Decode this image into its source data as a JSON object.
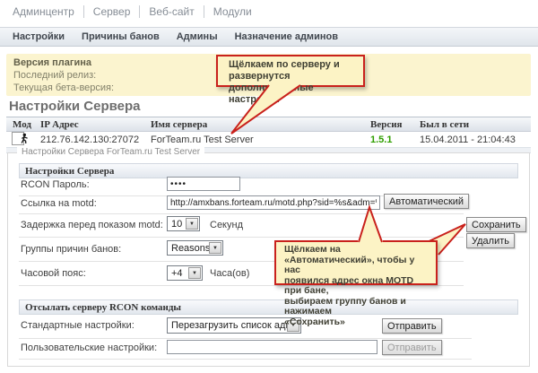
{
  "colors": {
    "accent-red": "#c9211c",
    "callout-bg": "#fcf3c5",
    "band-yellow": "#fbf4cf",
    "version-green": "#2f9e00"
  },
  "topnav": {
    "items": [
      "Админцентр",
      "Сервер",
      "Веб-сайт",
      "Модули"
    ]
  },
  "subnav": {
    "items": [
      "Настройки",
      "Причины банов",
      "Админы",
      "Назначение админов"
    ]
  },
  "plugin_box": {
    "title": "Версия плагина",
    "release_label": "Последний релиз:",
    "beta_label": "Текущая бета-версия:"
  },
  "callout_server": {
    "line1": "Щёлкаем по серверу и развернутся",
    "line2": "дополнительные настройки"
  },
  "callout_motd": {
    "line1": "Щёлкаем на «Автоматический», чтобы у нас",
    "line2": "появился адрес окна MOTD при бане,",
    "line3": "выбираем группу банов и нажимаем",
    "line4": "«Сохранить»"
  },
  "page_title": "Настройки Сервера",
  "server_table": {
    "headers": [
      "Мод",
      "IP Адрес",
      "Имя сервера",
      "Версия",
      "Был в сети"
    ],
    "row": {
      "mod_icon": "cs-player-icon",
      "ip": "212.76.142.130:27072",
      "name": "ForTeam.ru Test Server",
      "version": "1.5.1",
      "last_seen": "15.04.2011 - 21:04:43"
    }
  },
  "settings": {
    "legend": "Настройки Сервера ForTeam.ru Test Server",
    "section1_title": "Настройки Сервера",
    "rcon_label": "RCON Пароль:",
    "rcon_value": "••••",
    "motd_label": "Ссылка на motd:",
    "motd_value": "http://amxbans.forteam.ru/motd.php?sid=%s&adm=%d&lang=%s",
    "auto_button": "Автоматический",
    "delay_label": "Задержка перед показом motd:",
    "delay_value": "10",
    "delay_unit": "Секунд",
    "reasons_label": "Группы причин банов:",
    "reasons_value": "Reasons",
    "tz_label": "Часовой пояс:",
    "tz_value": "+4",
    "tz_unit": "Часа(ов)",
    "save_button": "Сохранить",
    "delete_button": "Удалить",
    "section2_title": "Отсылать серверу RCON команды",
    "std_label": "Стандартные настройки:",
    "std_value": "Перезагрузить список админов",
    "send_button": "Отправить",
    "custom_label": "Пользовательские настройки:",
    "send_custom_button": "Отправить",
    "dropdown_icon": "▼"
  }
}
